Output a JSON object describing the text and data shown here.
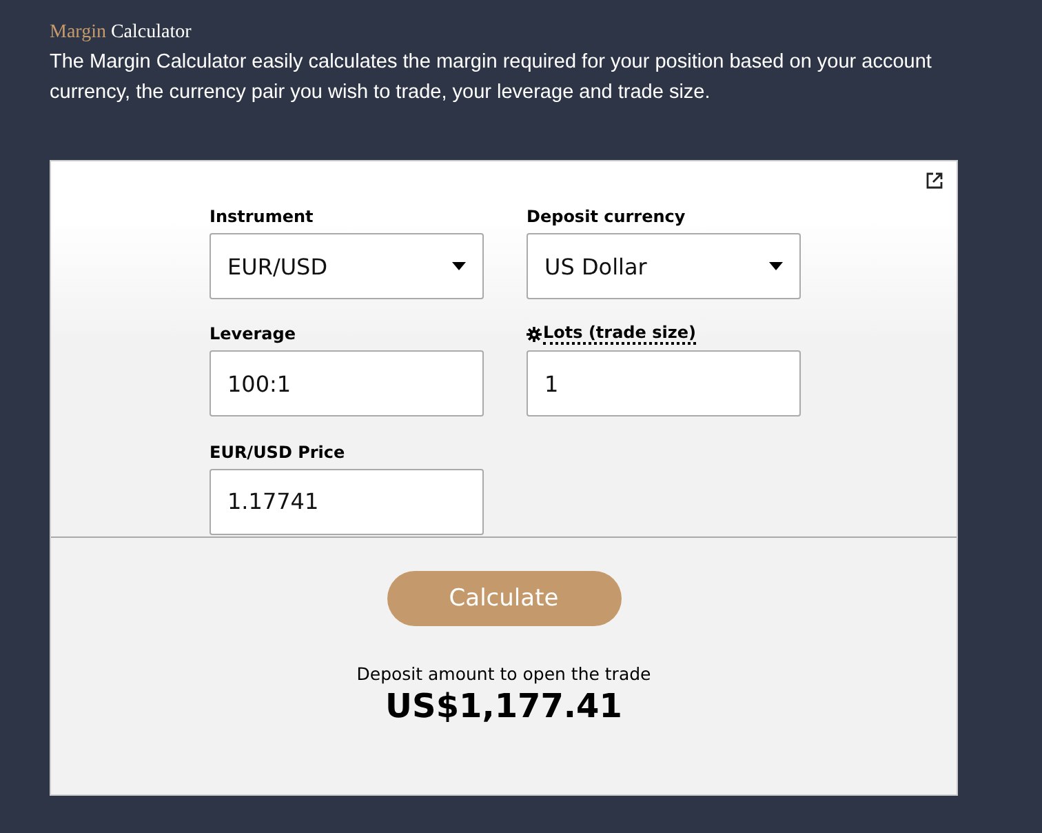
{
  "header": {
    "title_accent": "Margin",
    "title_rest": "Calculator",
    "description": "The Margin Calculator easily calculates the margin required for your position based on your account currency, the currency pair you wish to trade, your leverage and trade size."
  },
  "fields": [
    {
      "kind": "select",
      "label": "Instrument",
      "value": "EUR/USD"
    },
    {
      "kind": "select",
      "label": "Deposit currency",
      "value": "US Dollar"
    },
    {
      "kind": "input",
      "label": "Leverage",
      "value": "100:1"
    },
    {
      "kind": "input",
      "label": "Lots (trade size)",
      "value": "1",
      "tooltip": true
    },
    {
      "kind": "input",
      "label": "EUR/USD Price",
      "value": "1.17741"
    }
  ],
  "button": "Calculate",
  "result": {
    "label": "Deposit amount to open the trade",
    "amount": "US$1,177.41"
  }
}
